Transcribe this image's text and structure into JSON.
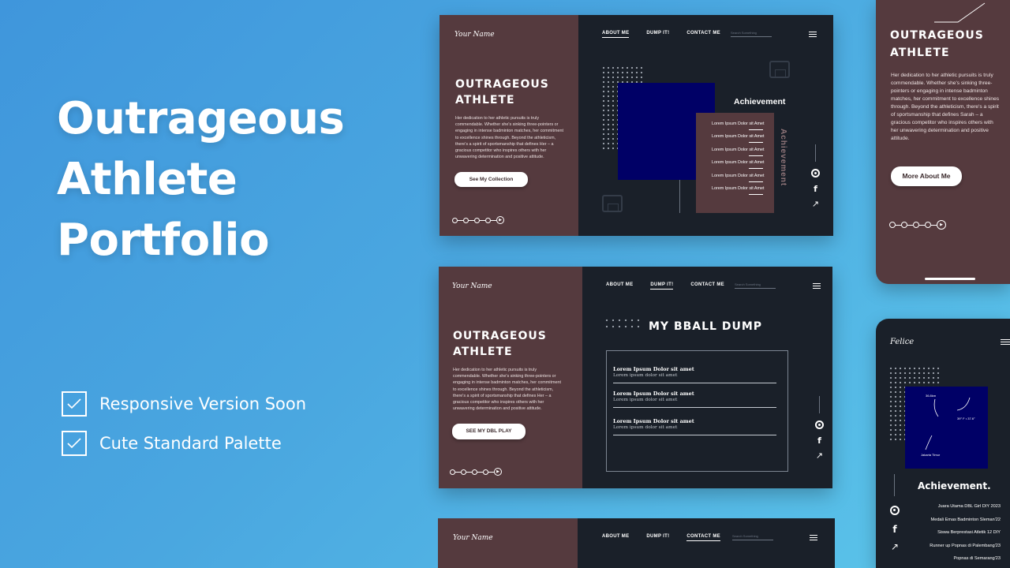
{
  "hero": {
    "lines": [
      "Outrageous",
      "Athlete",
      "Portfolio"
    ]
  },
  "features": [
    {
      "label": "Responsive Version Soon"
    },
    {
      "label": "Cute Standard Palette"
    }
  ],
  "site": {
    "logo": "Your Name",
    "nav": [
      "ABOUT ME",
      "DUMP IT!",
      "CONTACT ME"
    ],
    "search_placeholder": "Search Something",
    "title_lines": [
      "OUTRAGEOUS",
      "ATHLETE"
    ],
    "about": "Her dedication to her athletic pursuits is truly commendable. Whether she's sinking three-pointers or engaging in intense badminton matches, her commitment to excellence shines through. Beyond the athleticism, there's a spirit of sportsmanship that defines Her – a gracious competitor who inspires others with her unwavering determination and positive attitude."
  },
  "screen1": {
    "cta": "See My Collection",
    "achievement_heading": "Achievement",
    "achievement_vertical": "Achievement",
    "items": [
      "Lorem Ipsum Dolor sit Amet",
      "Lorem Ipsum Dolor sit Amet",
      "Lorem Ipsum Dolor sit Amet",
      "Lorem Ipsum Dolor sit Amet",
      "Lorem Ipsum Dolor sit Amet",
      "Lorem Ipsum Dolor sit Amet"
    ]
  },
  "screen2": {
    "cta": "SEE MY DBL PLAY",
    "heading": "MY BBALL DUMP",
    "entries": [
      {
        "title": "Lorem Ipsum Dolor sit amet",
        "sub": "Lorem ipsum dolor sit amet"
      },
      {
        "title": "Lorem Ipsum Dolor sit amet",
        "sub": "Lorem ipsum dolor sit amet"
      },
      {
        "title": "Lorem Ipsum Dolor sit amet",
        "sub": "Lorem ipsum dolor sit amet"
      }
    ]
  },
  "mobile1": {
    "about": "Her dedication to her athletic pursuits is truly commendable. Whether she's sinking three-pointers or engaging in intense badminton matches, her commitment to excellence shines through. Beyond the athleticism, there's a spirit of sportsmanship that defines Sarah – a gracious competitor who inspires others with her unwavering determination and positive attitude.",
    "cta": "More About Me"
  },
  "mobile2": {
    "logo": "Felice",
    "heading": "Achievement.",
    "map_labels": [
      "36.8km",
      "39° F • 37.6°",
      "Jakarta Timur"
    ],
    "items": [
      "Juara Utama DBL Girl DIY 2023",
      "Medali Emas Badminton Sleman'22",
      "Siswa Berprestasi Atletik 12 DIY",
      "Runner up Popnas di Palembang'23",
      "Popnas di Semarang'23"
    ]
  },
  "icons": {
    "check": "check-icon",
    "target": "target-icon",
    "facebook": "facebook-icon",
    "external": "external-link-icon",
    "play": "play-icon",
    "menu": "menu-icon"
  },
  "colors": {
    "background_from": "#3f96dc",
    "background_to": "#5cc6ea",
    "maroon": "#553a3e",
    "dark": "#1a2029",
    "navy": "#000066"
  }
}
